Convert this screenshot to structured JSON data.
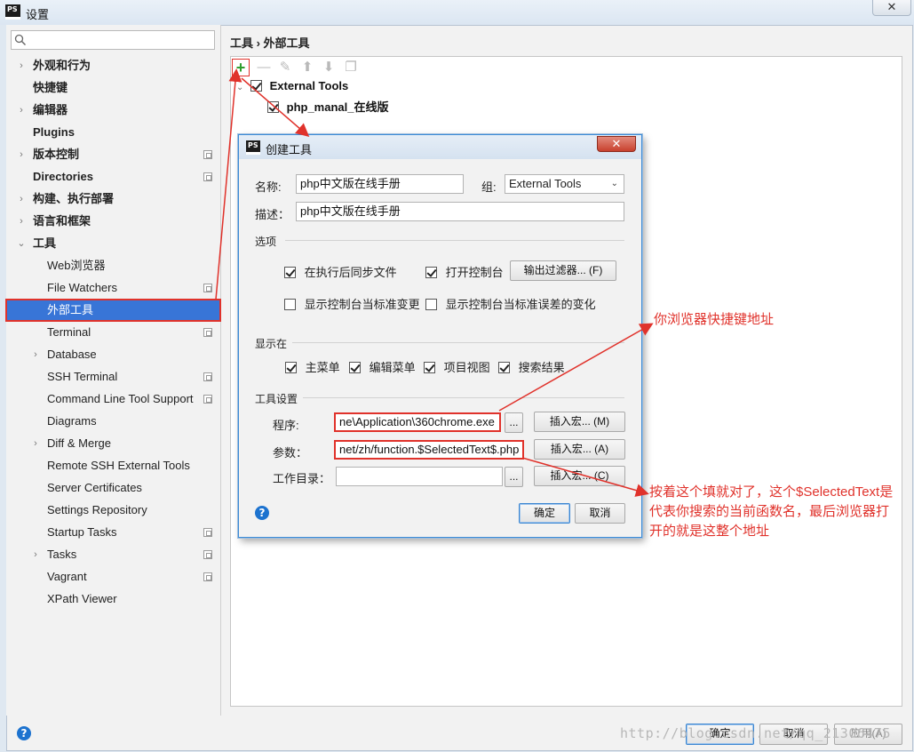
{
  "window": {
    "title": "设置",
    "close_glyph": "✕",
    "logo_text": "PS"
  },
  "sidebar": {
    "search_placeholder": "",
    "items": [
      {
        "label": "外观和行为",
        "arrow": "›",
        "bold": true
      },
      {
        "label": "快捷键",
        "bold": true
      },
      {
        "label": "编辑器",
        "arrow": "›",
        "bold": true
      },
      {
        "label": "Plugins",
        "bold": true
      },
      {
        "label": "版本控制",
        "arrow": "›",
        "bold": true,
        "config": true
      },
      {
        "label": "Directories",
        "bold": true,
        "config": true
      },
      {
        "label": "构建、执行部署",
        "arrow": "›",
        "bold": true
      },
      {
        "label": "语言和框架",
        "arrow": "›",
        "bold": true
      },
      {
        "label": "工具",
        "arrow": "⌄",
        "bold": true
      },
      {
        "label": "Web浏览器"
      },
      {
        "label": "File Watchers",
        "config": true
      },
      {
        "label": "外部工具",
        "selected": true
      },
      {
        "label": "Terminal",
        "config": true
      },
      {
        "label": "Database",
        "arrow": "›"
      },
      {
        "label": "SSH Terminal",
        "config": true
      },
      {
        "label": "Command Line Tool Support",
        "config": true
      },
      {
        "label": "Diagrams"
      },
      {
        "label": "Diff & Merge",
        "arrow": "›"
      },
      {
        "label": "Remote SSH External Tools"
      },
      {
        "label": "Server Certificates"
      },
      {
        "label": "Settings Repository"
      },
      {
        "label": "Startup Tasks",
        "config": true
      },
      {
        "label": "Tasks",
        "arrow": "›",
        "config": true
      },
      {
        "label": "Vagrant",
        "config": true
      },
      {
        "label": "XPath Viewer"
      }
    ]
  },
  "main": {
    "breadcrumb": "工具 › 外部工具",
    "tree": {
      "group": "External Tools",
      "tool": "php_manal_在线版"
    }
  },
  "dialog": {
    "title": "创建工具",
    "logo_text": "PS",
    "close_glyph": "✕",
    "name_label": "名称:",
    "name_value": "php中文版在线手册",
    "group_label": "组:",
    "group_value": "External Tools",
    "desc_label": "描述：",
    "desc_value": "php中文版在线手册",
    "options_title": "选项",
    "opt_sync": "在执行后同步文件",
    "opt_console": "打开控制台",
    "output_filter_btn": "输出过滤器... (F)",
    "opt_stdout": "显示控制台当标准变更",
    "opt_stderr": "显示控制台当标准误差的变化",
    "show_in_title": "显示在",
    "show_main_menu": "主菜单",
    "show_editor_menu": "编辑菜单",
    "show_project_view": "项目视图",
    "show_search_results": "搜索结果",
    "tool_settings_title": "工具设置",
    "program_label": "程序:",
    "program_value": "ne\\Application\\360chrome.exe",
    "params_label": "参数：",
    "params_value": "net/zh/function.$SelectedText$.php",
    "workdir_label": "工作目录：",
    "workdir_value": "",
    "browse_label": "...",
    "insert_macro_m": "插入宏... (M)",
    "insert_macro_a": "插入宏... (A)",
    "insert_macro_c": "插入宏... (C)",
    "ok": "确定",
    "cancel": "取消",
    "help_glyph": "?"
  },
  "footer": {
    "ok": "确定",
    "cancel": "取消",
    "apply": "应用(A)",
    "help_glyph": "?"
  },
  "annotations": {
    "browser_path": "你浏览器快捷键地址",
    "params_note_line1": "按着这个填就对了，这个$SelectedText是",
    "params_note_line2": "代表你搜索的当前函数名，最后浏览器打",
    "params_note_line3": "开的就是这整个地址"
  },
  "watermark": "http://blog.csdn.net/qq_21306475",
  "colors": {
    "selection": "#3875d7",
    "annotation": "#e0322b",
    "add_icon": "#2f9e2f"
  }
}
